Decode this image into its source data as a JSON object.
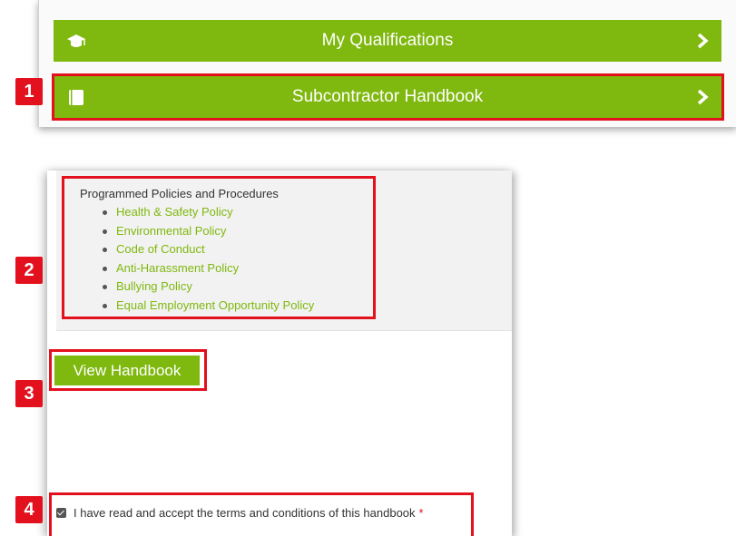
{
  "menu": {
    "qualifications_label": "My Qualifications",
    "handbook_label": "Subcontractor Handbook"
  },
  "icons": {
    "qualifications": "graduation-cap-icon",
    "handbook": "book-icon",
    "arrow": "chevron-right-icon"
  },
  "policies": {
    "title": "Programmed Policies and Procedures",
    "items": [
      "Health & Safety Policy",
      "Environmental Policy",
      "Code of Conduct",
      "Anti-Harassment Policy",
      "Bullying Policy",
      "Equal Employment Opportunity Policy"
    ]
  },
  "actions": {
    "view_handbook_label": "View Handbook"
  },
  "acceptance": {
    "checked": true,
    "label": "I have read and accept the terms and conditions of this handbook",
    "required_marker": "*"
  },
  "callouts": [
    "1",
    "2",
    "3",
    "4"
  ],
  "colors": {
    "accent_green": "#7fb80e",
    "callout_red": "#e3101d"
  }
}
